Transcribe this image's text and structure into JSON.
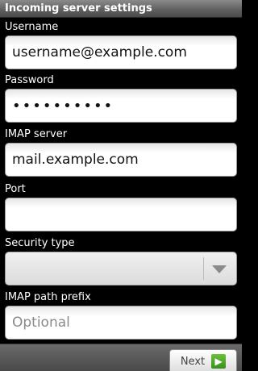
{
  "header": {
    "title": "Incoming server settings"
  },
  "form": {
    "username": {
      "label": "Username",
      "value": "username@example.com"
    },
    "password": {
      "label": "Password",
      "value": "••••••••••"
    },
    "imap_server": {
      "label": "IMAP server",
      "value": "mail.example.com"
    },
    "port": {
      "label": "Port",
      "value": ""
    },
    "security_type": {
      "label": "Security type",
      "value": ""
    },
    "imap_path_prefix": {
      "label": "IMAP path prefix",
      "placeholder": "Optional"
    }
  },
  "footer": {
    "next_label": "Next",
    "next_icon": "arrow-right-icon"
  }
}
